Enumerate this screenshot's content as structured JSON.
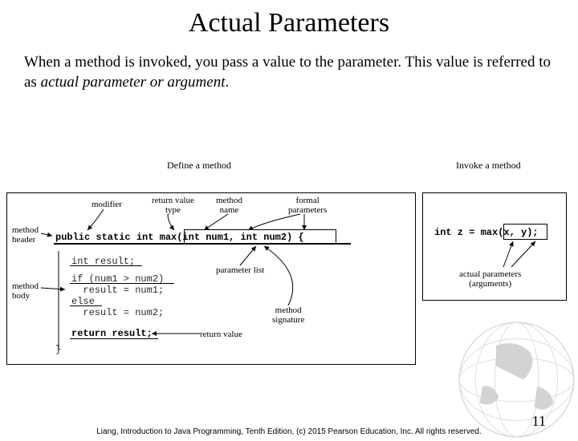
{
  "title": "Actual Parameters",
  "body_pre": "When a method is invoked, you pass a value to the parameter. This value is referred to as ",
  "body_ital": "actual parameter or argument",
  "body_post": ".",
  "left": {
    "header": "Define a method",
    "labels": {
      "modifier": "modifier",
      "return_type": "return value\ntype",
      "method_name": "method\nname",
      "formal_params": "formal\nparameters",
      "method_header": "method\nheader",
      "method_body": "method\nbody",
      "param_list": "parameter list",
      "method_sig": "method\nsignature",
      "return_val": "return value"
    },
    "code": {
      "sig": "public static int max(int num1, int num2) {",
      "l1": "int result;",
      "l2": "if (num1 > num2)",
      "l3": "  result = num1;",
      "l4": "else",
      "l5": "  result = num2;",
      "l6": "return result;",
      "l7": "}"
    }
  },
  "right": {
    "header": "Invoke a method",
    "code": "int z = max(x, y);",
    "label": "actual parameters\n(arguments)"
  },
  "footer": "Liang, Introduction to Java Programming, Tenth Edition, (c) 2015 Pearson Education, Inc. All\nrights reserved.",
  "page": "11"
}
